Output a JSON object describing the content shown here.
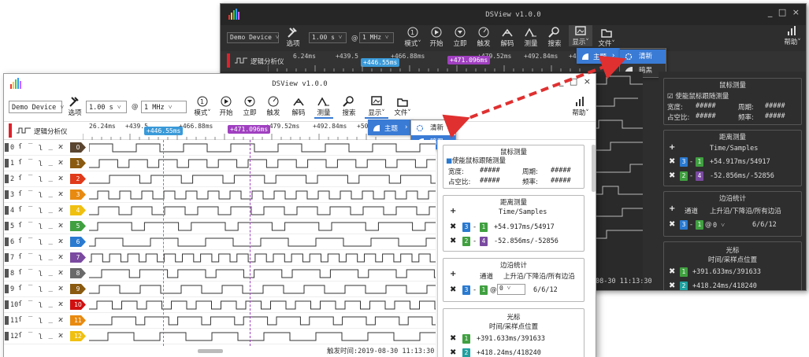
{
  "app_title": "DSView v1.0.0",
  "toolbar": {
    "device": "Demo Device",
    "options_label": "选项",
    "duration": "1.00 s",
    "at": "@",
    "rate": "1 MHz",
    "mode_label": "模式",
    "start_label": "开始",
    "instant_label": "立即",
    "trigger_label": "触发",
    "decode_label": "解码",
    "measure_label": "测量",
    "search_label": "搜索",
    "display_label": "显示",
    "file_label": "文件",
    "help_label": "帮助"
  },
  "tab": {
    "label": "逻辑分析仪"
  },
  "ruler": {
    "ticks": [
      "26.24ms",
      "+439.5",
      "+446.55ms",
      "+466.88ms",
      "+471.096ms",
      "+479.52ms",
      "+492.84ms",
      "+50"
    ],
    "dark_ticks": [
      "6.24ms",
      "+439.5",
      "+446.55ms",
      "+466.88ms",
      "+471.096ms",
      "+479.52ms",
      "+492.84ms",
      "+4"
    ],
    "cursor1": "+446.55ms",
    "cursor2": "+471.096ms"
  },
  "menu": {
    "theme_label": "主题",
    "light": "清新",
    "dark": "暗黑"
  },
  "channels": [
    {
      "num": "0",
      "tag": "0",
      "color": "#5a4530"
    },
    {
      "num": "1",
      "tag": "1",
      "color": "#8a5a10"
    },
    {
      "num": "2",
      "tag": "2",
      "color": "#e03a1a"
    },
    {
      "num": "3",
      "tag": "3",
      "color": "#e88a10"
    },
    {
      "num": "4",
      "tag": "4",
      "color": "#f0c010"
    },
    {
      "num": "5",
      "tag": "5",
      "color": "#40a040"
    },
    {
      "num": "6",
      "tag": "6",
      "color": "#2a7ad0"
    },
    {
      "num": "7",
      "tag": "7",
      "color": "#7a4aa0"
    },
    {
      "num": "8",
      "tag": "8",
      "color": "#6a6a6a"
    },
    {
      "num": "9",
      "tag": "9",
      "color": "#8a5a10"
    },
    {
      "num": "10",
      "tag": "10",
      "color": "#d01010"
    },
    {
      "num": "11",
      "tag": "11",
      "color": "#e88a10"
    },
    {
      "num": "12",
      "tag": "12",
      "color": "#f0c010"
    }
  ],
  "trigger_glyphs": "ſ ‾ ʅ _ ϰ",
  "status": {
    "trigger_time": "触发时间:2019-08-30 11:13:30",
    "dark_time": "08-30 11:13:30"
  },
  "dock": {
    "cursor_measure": {
      "title": "鼠标测量",
      "enable_label": "使能鼠标跟随测量",
      "width_label": "宽度:",
      "width_val": "#####",
      "period_label": "周期:",
      "period_val": "#####",
      "duty_label": "占空比:",
      "duty_val": "#####",
      "freq_label": "频率:",
      "freq_val": "#####"
    },
    "distance": {
      "title": "距离测量",
      "header": "Time/Samples",
      "row1": {
        "a": "3",
        "b": "1",
        "val": "+54.917ms/54917"
      },
      "row2": {
        "a": "2",
        "b": "4",
        "val": "-52.856ms/-52856"
      }
    },
    "edges": {
      "title": "边沿统计",
      "channel_label": "通道",
      "edge_label": "上升沿/下降沿/所有边沿",
      "a": "3",
      "b": "1",
      "at": "@",
      "ch": "0",
      "val": "6/6/12"
    },
    "cursors": {
      "title": "光标",
      "header": "时间/采样点位置",
      "row1": {
        "n": "1",
        "val": "+391.633ms/391633"
      },
      "row2": {
        "n": "2",
        "val": "+418.24ms/418240"
      }
    }
  },
  "colors": {
    "cursor1": "#3a9ad9",
    "cursor2": "#a040c0",
    "accent_red": "#e0202a",
    "arrow": "#e03030"
  }
}
